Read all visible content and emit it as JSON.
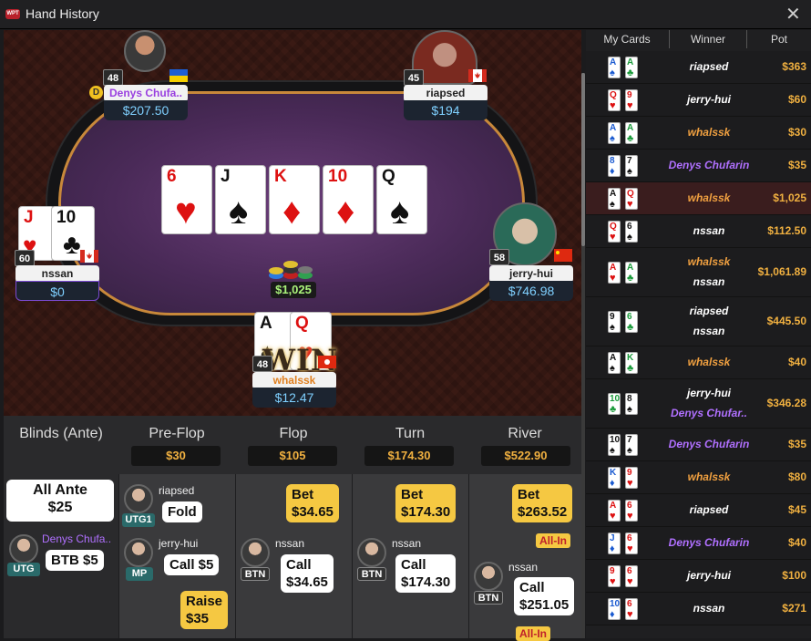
{
  "window": {
    "title": "Hand History",
    "close_glyph": "✕",
    "logo_text": "WPT"
  },
  "table": {
    "board": [
      {
        "rank": "6",
        "suit": "♥",
        "color": "red"
      },
      {
        "rank": "J",
        "suit": "♠",
        "color": "black"
      },
      {
        "rank": "K",
        "suit": "♦",
        "color": "red"
      },
      {
        "rank": "10",
        "suit": "♦",
        "color": "red"
      },
      {
        "rank": "Q",
        "suit": "♠",
        "color": "black"
      }
    ],
    "pot": "$1,025",
    "win_label": "WIN",
    "dealer_label": "D",
    "players": [
      {
        "name": "Denys Chufa..",
        "stack": "$207.50",
        "level": "48",
        "flag": "ukraine"
      },
      {
        "name": "riapsed",
        "stack": "$194",
        "level": "45",
        "flag": "canada"
      },
      {
        "name": "nssan",
        "stack": "$0",
        "level": "60",
        "flag": "canada",
        "cards": [
          {
            "rank": "J",
            "suit": "♥",
            "color": "red"
          },
          {
            "rank": "10",
            "suit": "♣",
            "color": "black"
          }
        ]
      },
      {
        "name": "jerry-hui",
        "stack": "$746.98",
        "level": "58",
        "flag": "china"
      },
      {
        "name": "whalssk",
        "stack": "$12.47",
        "level": "48",
        "flag": "hongkong",
        "cards": [
          {
            "rank": "A",
            "suit": "♠",
            "color": "black"
          },
          {
            "rank": "Q",
            "suit": "♥",
            "color": "red"
          }
        ]
      }
    ]
  },
  "history": {
    "headers": {
      "cards": "My Cards",
      "winner": "Winner",
      "pot": "Pot"
    },
    "rows": [
      {
        "cards": [
          [
            "A",
            "♠",
            "b"
          ],
          [
            "A",
            "♣",
            "g"
          ]
        ],
        "winners": [
          {
            "n": "riapsed",
            "c": "#fff"
          }
        ],
        "pot": "$363"
      },
      {
        "cards": [
          [
            "Q",
            "♥",
            "r"
          ],
          [
            "9",
            "♥",
            "r"
          ]
        ],
        "winners": [
          {
            "n": "jerry-hui",
            "c": "#fff"
          }
        ],
        "pot": "$60"
      },
      {
        "cards": [
          [
            "A",
            "♠",
            "b"
          ],
          [
            "A",
            "♣",
            "g"
          ]
        ],
        "winners": [
          {
            "n": "whalssk",
            "c": "#f0a040"
          }
        ],
        "pot": "$30"
      },
      {
        "cards": [
          [
            "8",
            "♦",
            "b"
          ],
          [
            "7",
            "♠",
            "k"
          ]
        ],
        "winners": [
          {
            "n": "Denys Chufarin",
            "c": "#b070ff"
          }
        ],
        "pot": "$35"
      },
      {
        "cards": [
          [
            "A",
            "♠",
            "k"
          ],
          [
            "Q",
            "♥",
            "r"
          ]
        ],
        "winners": [
          {
            "n": "whalssk",
            "c": "#f0a040"
          }
        ],
        "pot": "$1,025",
        "selected": true
      },
      {
        "cards": [
          [
            "Q",
            "♥",
            "r"
          ],
          [
            "6",
            "♠",
            "k"
          ]
        ],
        "winners": [
          {
            "n": "nssan",
            "c": "#fff"
          }
        ],
        "pot": "$112.50"
      },
      {
        "cards": [
          [
            "A",
            "♥",
            "r"
          ],
          [
            "A",
            "♣",
            "g"
          ]
        ],
        "winners": [
          {
            "n": "whalssk",
            "c": "#f0a040"
          },
          {
            "n": "nssan",
            "c": "#fff"
          }
        ],
        "pot": "$1,061.89"
      },
      {
        "cards": [
          [
            "9",
            "♠",
            "k"
          ],
          [
            "6",
            "♣",
            "g"
          ]
        ],
        "winners": [
          {
            "n": "riapsed",
            "c": "#fff"
          },
          {
            "n": "nssan",
            "c": "#fff"
          }
        ],
        "pot": "$445.50"
      },
      {
        "cards": [
          [
            "A",
            "♠",
            "k"
          ],
          [
            "K",
            "♣",
            "g"
          ]
        ],
        "winners": [
          {
            "n": "whalssk",
            "c": "#f0a040"
          }
        ],
        "pot": "$40"
      },
      {
        "cards": [
          [
            "10",
            "♣",
            "g"
          ],
          [
            "8",
            "♠",
            "k"
          ]
        ],
        "winners": [
          {
            "n": "jerry-hui",
            "c": "#fff"
          },
          {
            "n": "Denys Chufar..",
            "c": "#b070ff"
          }
        ],
        "pot": "$346.28"
      },
      {
        "cards": [
          [
            "10",
            "♠",
            "k"
          ],
          [
            "7",
            "♠",
            "k"
          ]
        ],
        "winners": [
          {
            "n": "Denys Chufarin",
            "c": "#b070ff"
          }
        ],
        "pot": "$35"
      },
      {
        "cards": [
          [
            "K",
            "♦",
            "b"
          ],
          [
            "9",
            "♥",
            "r"
          ]
        ],
        "winners": [
          {
            "n": "whalssk",
            "c": "#f0a040"
          }
        ],
        "pot": "$80"
      },
      {
        "cards": [
          [
            "A",
            "♥",
            "r"
          ],
          [
            "6",
            "♥",
            "r"
          ]
        ],
        "winners": [
          {
            "n": "riapsed",
            "c": "#fff"
          }
        ],
        "pot": "$45"
      },
      {
        "cards": [
          [
            "J",
            "♦",
            "b"
          ],
          [
            "6",
            "♥",
            "r"
          ]
        ],
        "winners": [
          {
            "n": "Denys Chufarin",
            "c": "#b070ff"
          }
        ],
        "pot": "$40"
      },
      {
        "cards": [
          [
            "9",
            "♥",
            "r"
          ],
          [
            "6",
            "♥",
            "r"
          ]
        ],
        "winners": [
          {
            "n": "jerry-hui",
            "c": "#fff"
          }
        ],
        "pot": "$100"
      },
      {
        "cards": [
          [
            "10",
            "♦",
            "b"
          ],
          [
            "6",
            "♥",
            "r"
          ]
        ],
        "winners": [
          {
            "n": "nssan",
            "c": "#fff"
          }
        ],
        "pot": "$271"
      }
    ]
  },
  "actions": {
    "columns": [
      {
        "title": "Blinds (Ante)"
      },
      {
        "title": "Pre-Flop",
        "pot": "$30"
      },
      {
        "title": "Flop",
        "pot": "$105"
      },
      {
        "title": "Turn",
        "pot": "$174.30"
      },
      {
        "title": "River",
        "pot": "$522.90"
      }
    ],
    "blinds": {
      "ante_label": "All Ante",
      "ante_amount": "$25",
      "player": "Denys Chufa..",
      "pos": "UTG",
      "action": "BTB $5"
    },
    "preflop": [
      {
        "player": "riapsed",
        "pos": "UTG1",
        "action": "Fold"
      },
      {
        "player": "jerry-hui",
        "pos": "MP",
        "action": "Call $5"
      },
      {
        "action_line1": "Raise",
        "action_line2": "$35"
      }
    ],
    "flop": {
      "bet1": "Bet",
      "bet2": "$34.65",
      "player": "nssan",
      "pos": "BTN",
      "call1": "Call",
      "call2": "$34.65"
    },
    "turn": {
      "bet1": "Bet",
      "bet2": "$174.30",
      "player": "nssan",
      "pos": "BTN",
      "call1": "Call",
      "call2": "$174.30"
    },
    "river": {
      "bet1": "Bet",
      "bet2": "$263.52",
      "allin": "All-In",
      "player": "nssan",
      "pos": "BTN",
      "call1": "Call",
      "call2": "$251.05",
      "allin2": "All-In"
    }
  }
}
